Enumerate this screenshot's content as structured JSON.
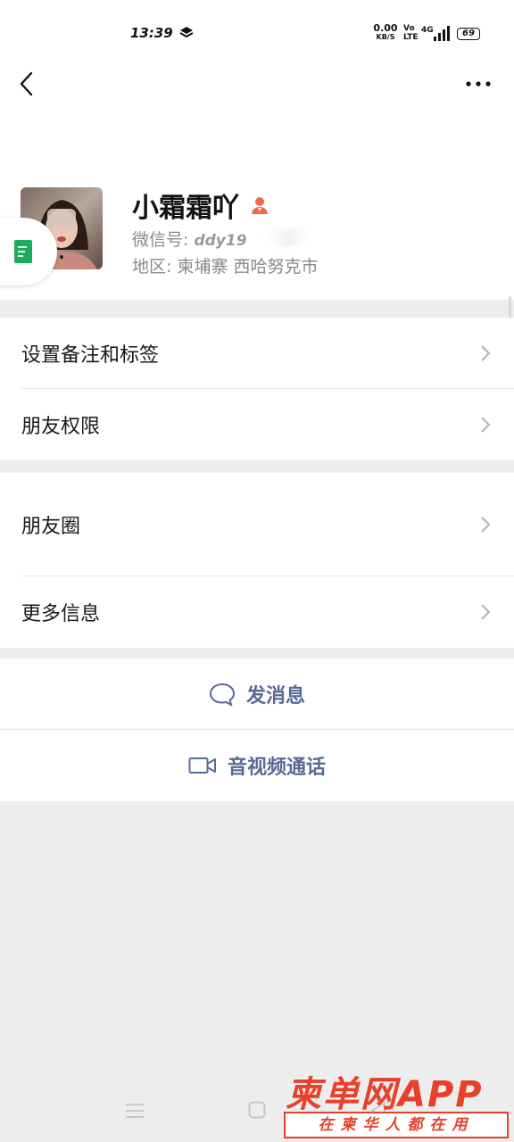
{
  "status_bar": {
    "time": "13:39",
    "net_speed": "0.00",
    "net_unit": "KB/S",
    "volte": "Vo LTE",
    "network": "4G",
    "battery": "69"
  },
  "profile": {
    "nickname": "小霜霜吖",
    "wechat_id_label": "微信号:",
    "wechat_id_value": "ddy19",
    "region_label": "地区:",
    "region_value": "柬埔寨  西哈努克市"
  },
  "menu_group_1": [
    {
      "label": "设置备注和标签"
    },
    {
      "label": "朋友权限"
    }
  ],
  "menu_group_2": [
    {
      "label": "朋友圈"
    },
    {
      "label": "更多信息"
    }
  ],
  "actions": {
    "message": "发消息",
    "video_call": "音视频通话"
  },
  "watermark": {
    "title": "柬单网APP",
    "subtitle": "在柬华人都在用"
  },
  "colors": {
    "link_blue": "#576b95",
    "background_gray": "#ededed",
    "watermark_red": "#e8412b"
  }
}
